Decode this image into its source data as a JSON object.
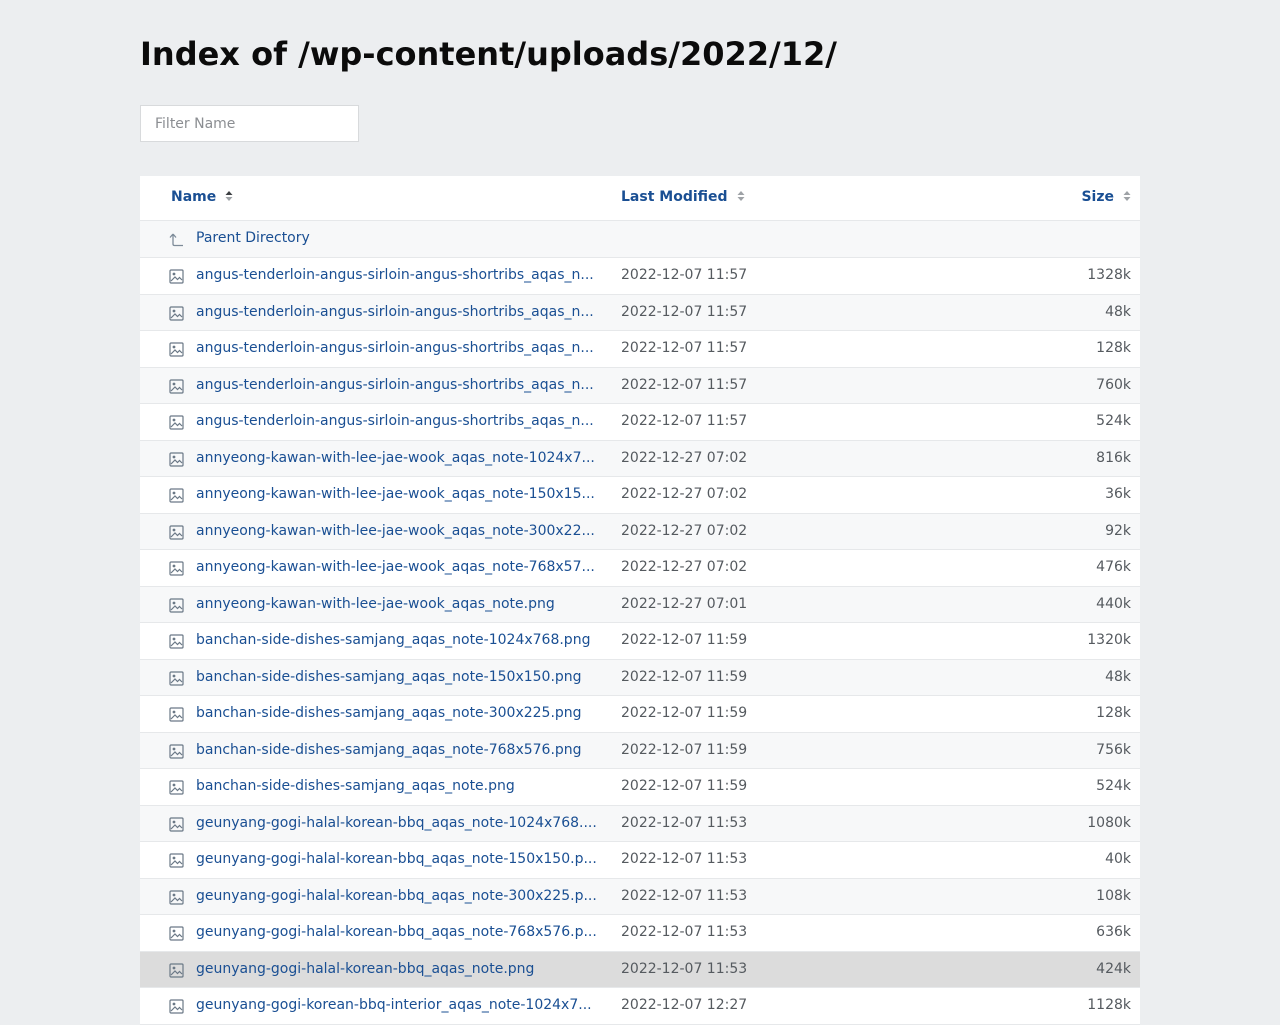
{
  "page": {
    "title": "Index of /wp-content/uploads/2022/12/",
    "filter_placeholder": "Filter Name"
  },
  "columns": {
    "name": "Name",
    "modified": "Last Modified",
    "size": "Size"
  },
  "parent": {
    "label": "Parent Directory",
    "icon": "parent-directory-icon"
  },
  "rows": [
    {
      "name": "angus-tenderloin-angus-sirloin-angus-shortribs_aqas_n...",
      "date": "2022-12-07 11:57",
      "size": "1328k"
    },
    {
      "name": "angus-tenderloin-angus-sirloin-angus-shortribs_aqas_n...",
      "date": "2022-12-07 11:57",
      "size": "48k"
    },
    {
      "name": "angus-tenderloin-angus-sirloin-angus-shortribs_aqas_n...",
      "date": "2022-12-07 11:57",
      "size": "128k"
    },
    {
      "name": "angus-tenderloin-angus-sirloin-angus-shortribs_aqas_n...",
      "date": "2022-12-07 11:57",
      "size": "760k"
    },
    {
      "name": "angus-tenderloin-angus-sirloin-angus-shortribs_aqas_n...",
      "date": "2022-12-07 11:57",
      "size": "524k"
    },
    {
      "name": "annyeong-kawan-with-lee-jae-wook_aqas_note-1024x7...",
      "date": "2022-12-27 07:02",
      "size": "816k"
    },
    {
      "name": "annyeong-kawan-with-lee-jae-wook_aqas_note-150x15...",
      "date": "2022-12-27 07:02",
      "size": "36k"
    },
    {
      "name": "annyeong-kawan-with-lee-jae-wook_aqas_note-300x22...",
      "date": "2022-12-27 07:02",
      "size": "92k"
    },
    {
      "name": "annyeong-kawan-with-lee-jae-wook_aqas_note-768x57...",
      "date": "2022-12-27 07:02",
      "size": "476k"
    },
    {
      "name": "annyeong-kawan-with-lee-jae-wook_aqas_note.png",
      "date": "2022-12-27 07:01",
      "size": "440k"
    },
    {
      "name": "banchan-side-dishes-samjang_aqas_note-1024x768.png",
      "date": "2022-12-07 11:59",
      "size": "1320k"
    },
    {
      "name": "banchan-side-dishes-samjang_aqas_note-150x150.png",
      "date": "2022-12-07 11:59",
      "size": "48k"
    },
    {
      "name": "banchan-side-dishes-samjang_aqas_note-300x225.png",
      "date": "2022-12-07 11:59",
      "size": "128k"
    },
    {
      "name": "banchan-side-dishes-samjang_aqas_note-768x576.png",
      "date": "2022-12-07 11:59",
      "size": "756k"
    },
    {
      "name": "banchan-side-dishes-samjang_aqas_note.png",
      "date": "2022-12-07 11:59",
      "size": "524k"
    },
    {
      "name": "geunyang-gogi-halal-korean-bbq_aqas_note-1024x768....",
      "date": "2022-12-07 11:53",
      "size": "1080k"
    },
    {
      "name": "geunyang-gogi-halal-korean-bbq_aqas_note-150x150.p...",
      "date": "2022-12-07 11:53",
      "size": "40k"
    },
    {
      "name": "geunyang-gogi-halal-korean-bbq_aqas_note-300x225.p...",
      "date": "2022-12-07 11:53",
      "size": "108k"
    },
    {
      "name": "geunyang-gogi-halal-korean-bbq_aqas_note-768x576.p...",
      "date": "2022-12-07 11:53",
      "size": "636k"
    },
    {
      "name": "geunyang-gogi-halal-korean-bbq_aqas_note.png",
      "date": "2022-12-07 11:53",
      "size": "424k",
      "highlighted": true
    },
    {
      "name": "geunyang-gogi-korean-bbq-interior_aqas_note-1024x7...",
      "date": "2022-12-07 12:27",
      "size": "1128k"
    }
  ],
  "colors": {
    "link": "#1a4f93",
    "background": "#eceef0",
    "highlight_row": "#dcdcdc"
  },
  "icons": {
    "file": "image-file-icon",
    "sort": "sort-arrows-icon"
  }
}
